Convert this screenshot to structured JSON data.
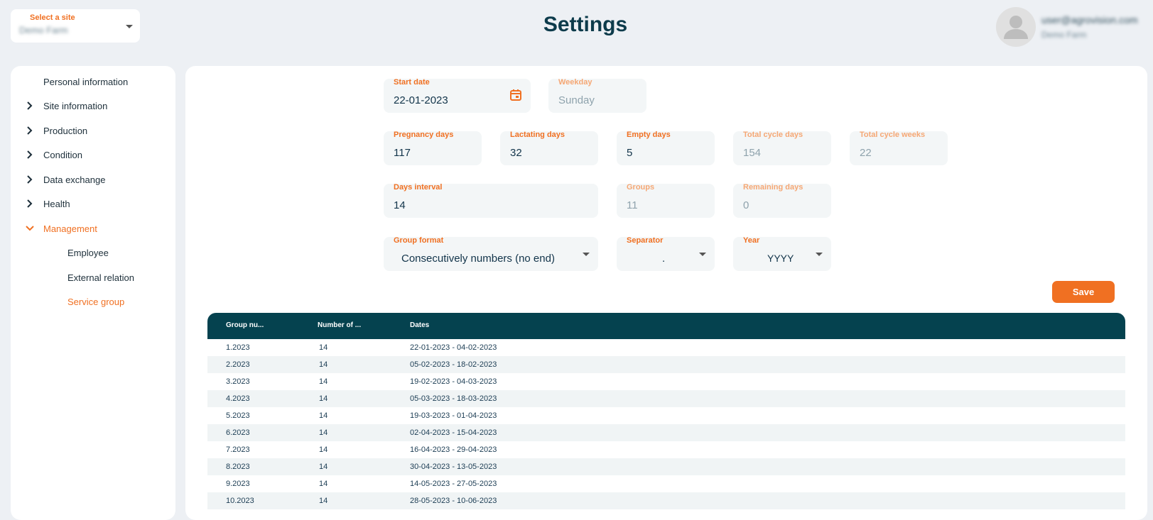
{
  "site": {
    "label": "Select a site",
    "value": "Demo Farm"
  },
  "page_title": "Settings",
  "user": {
    "email": "user@agrovision.com",
    "name": "Demo Farm"
  },
  "sidebar": {
    "items": [
      {
        "label": "Personal information",
        "chevron": "none"
      },
      {
        "label": "Site information",
        "chevron": "right"
      },
      {
        "label": "Production",
        "chevron": "right"
      },
      {
        "label": "Condition",
        "chevron": "right"
      },
      {
        "label": "Data exchange",
        "chevron": "right"
      },
      {
        "label": "Health",
        "chevron": "right"
      },
      {
        "label": "Management",
        "chevron": "down",
        "active": true
      },
      {
        "label": "Employee",
        "sub": true
      },
      {
        "label": "External relation",
        "sub": true
      },
      {
        "label": "Service group",
        "sub": true,
        "active": true
      }
    ]
  },
  "form": {
    "start_date": {
      "label": "Start date",
      "value": "22-01-2023",
      "icon": "calendar-icon"
    },
    "weekday": {
      "label": "Weekday",
      "value": "Sunday"
    },
    "pregnancy_days": {
      "label": "Pregnancy days",
      "value": "117"
    },
    "lactating_days": {
      "label": "Lactating days",
      "value": "32"
    },
    "empty_days": {
      "label": "Empty days",
      "value": "5"
    },
    "total_cycle_days": {
      "label": "Total cycle days",
      "value": "154"
    },
    "total_cycle_weeks": {
      "label": "Total cycle weeks",
      "value": "22"
    },
    "days_interval": {
      "label": "Days interval",
      "value": "14"
    },
    "groups": {
      "label": "Groups",
      "value": "11"
    },
    "remaining_days": {
      "label": "Remaining days",
      "value": "0"
    },
    "group_format": {
      "label": "Group format",
      "value": "Consecutively numbers (no end)"
    },
    "separator": {
      "label": "Separator",
      "value": "."
    },
    "year": {
      "label": "Year",
      "value": "YYYY"
    },
    "save_label": "Save"
  },
  "table": {
    "headers": [
      "Group nu...",
      "Number of ...",
      "Dates"
    ],
    "rows": [
      [
        "1.2023",
        "14",
        "22-01-2023 - 04-02-2023"
      ],
      [
        "2.2023",
        "14",
        "05-02-2023 - 18-02-2023"
      ],
      [
        "3.2023",
        "14",
        "19-02-2023 - 04-03-2023"
      ],
      [
        "4.2023",
        "14",
        "05-03-2023 - 18-03-2023"
      ],
      [
        "5.2023",
        "14",
        "19-03-2023 - 01-04-2023"
      ],
      [
        "6.2023",
        "14",
        "02-04-2023 - 15-04-2023"
      ],
      [
        "7.2023",
        "14",
        "16-04-2023 - 29-04-2023"
      ],
      [
        "8.2023",
        "14",
        "30-04-2023 - 13-05-2023"
      ],
      [
        "9.2023",
        "14",
        "14-05-2023 - 27-05-2023"
      ],
      [
        "10.2023",
        "14",
        "28-05-2023 - 10-06-2023"
      ]
    ]
  },
  "colors": {
    "accent": "#f07022",
    "header": "#05424f",
    "background": "#edf0f4"
  }
}
